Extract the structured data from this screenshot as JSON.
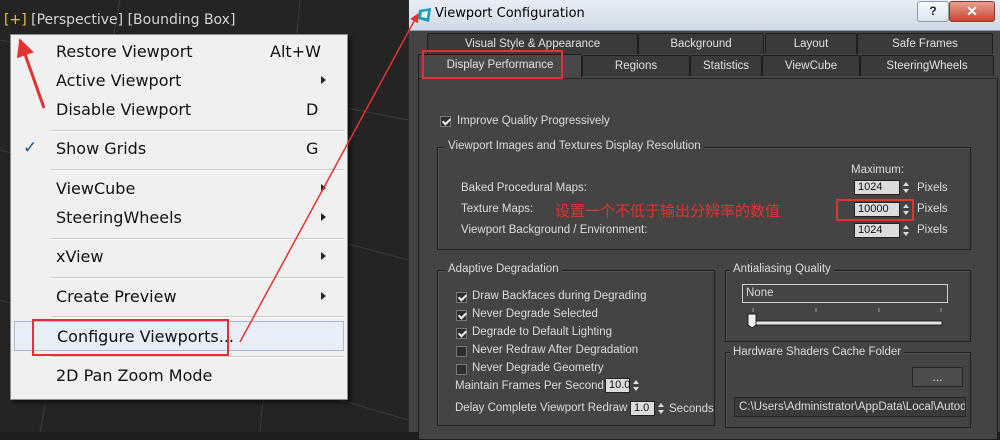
{
  "viewport": {
    "label_plus": "[+]",
    "label_view": "[Perspective]",
    "label_shading": "[Bounding Box]"
  },
  "context_menu": {
    "items": [
      {
        "label": "Restore Viewport",
        "shortcut": "Alt+W"
      },
      {
        "label": "Active Viewport",
        "submenu": true
      },
      {
        "label": "Disable Viewport",
        "shortcut": "D"
      },
      {
        "label": "Show Grids",
        "shortcut": "G",
        "checked": true
      },
      {
        "label": "ViewCube",
        "submenu": true
      },
      {
        "label": "SteeringWheels",
        "submenu": true
      },
      {
        "label": "xView",
        "submenu": true
      },
      {
        "label": "Create Preview",
        "submenu": true
      },
      {
        "label": "Configure Viewports...",
        "highlighted": true
      },
      {
        "label": "2D Pan Zoom Mode"
      }
    ],
    "check_glyph": "✓"
  },
  "dialog": {
    "title": "Viewport Configuration",
    "help_label": "?",
    "close_label": "✕",
    "tabs_row1": [
      "Visual Style & Appearance",
      "Background",
      "Layout",
      "Safe Frames"
    ],
    "tabs_row2": [
      "Display Performance",
      "Regions",
      "Statistics",
      "ViewCube",
      "SteeringWheels"
    ],
    "active_tab": "Display Performance",
    "improve_quality": {
      "label": "Improve Quality Progressively",
      "checked": true
    },
    "resolution_group": {
      "title": "Viewport Images and Textures Display Resolution",
      "maximum_label": "Maximum:",
      "unit": "Pixels",
      "rows": [
        {
          "label": "Baked Procedural Maps:",
          "value": "1024"
        },
        {
          "label": "Texture Maps:",
          "value": "10000"
        },
        {
          "label": "Viewport Background / Environment:",
          "value": "1024"
        }
      ]
    },
    "adaptive_group": {
      "title": "Adaptive Degradation",
      "options": [
        {
          "label": "Draw Backfaces during Degrading",
          "checked": true
        },
        {
          "label": "Never Degrade Selected",
          "checked": true
        },
        {
          "label": "Degrade to Default Lighting",
          "checked": true
        },
        {
          "label": "Never Redraw After Degradation",
          "checked": false
        },
        {
          "label": "Never Degrade Geometry",
          "checked": false
        }
      ],
      "fps_label": "Maintain Frames Per Second:",
      "fps_value": "10.0",
      "delay_label": "Delay Complete Viewport Redraw in",
      "delay_value": "1.0",
      "delay_unit": "Seconds"
    },
    "antialiasing_group": {
      "title": "Antialiasing Quality",
      "value": "None",
      "slider_level": 0
    },
    "cache_group": {
      "title": "Hardware Shaders Cache Folder",
      "browse_label": "...",
      "path": "C:\\Users\\Administrator\\AppData\\Local\\Autodesk"
    }
  },
  "annotation": {
    "text": "设置一个不低于输出分辨率的数值",
    "color": "#e53131"
  }
}
